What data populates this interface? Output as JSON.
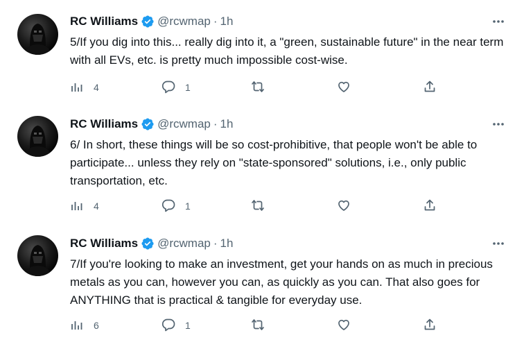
{
  "tweets": [
    {
      "name": "RC Williams",
      "handle": "@rcwmap",
      "dot": "·",
      "time": "1h",
      "text": "5/If you dig into this... really dig into it, a \"green, sustainable future\" in the near term with all EVs, etc. is pretty much impossible cost-wise.",
      "views": "4",
      "replies": "1"
    },
    {
      "name": "RC Williams",
      "handle": "@rcwmap",
      "dot": "·",
      "time": "1h",
      "text": "6/ In short, these things will be so cost-prohibitive, that people won't be able to participate... unless they rely on \"state-sponsored\" solutions, i.e., only public transportation, etc.",
      "views": "4",
      "replies": "1"
    },
    {
      "name": "RC Williams",
      "handle": "@rcwmap",
      "dot": "·",
      "time": "1h",
      "text": "7/If you're looking to make an investment, get your hands on as much in precious metals as you can, however you can, as quickly as you can. That also goes for ANYTHING that is practical & tangible for everyday use.",
      "views": "6",
      "replies": "1"
    }
  ],
  "icons": {
    "verified": "verified-badge-icon",
    "more": "more-icon",
    "views": "analytics-icon",
    "reply": "reply-icon",
    "retweet": "retweet-icon",
    "like": "like-icon",
    "share": "share-icon"
  },
  "colors": {
    "text": "#0f1419",
    "secondary": "#536471",
    "verified": "#1d9bf0"
  }
}
